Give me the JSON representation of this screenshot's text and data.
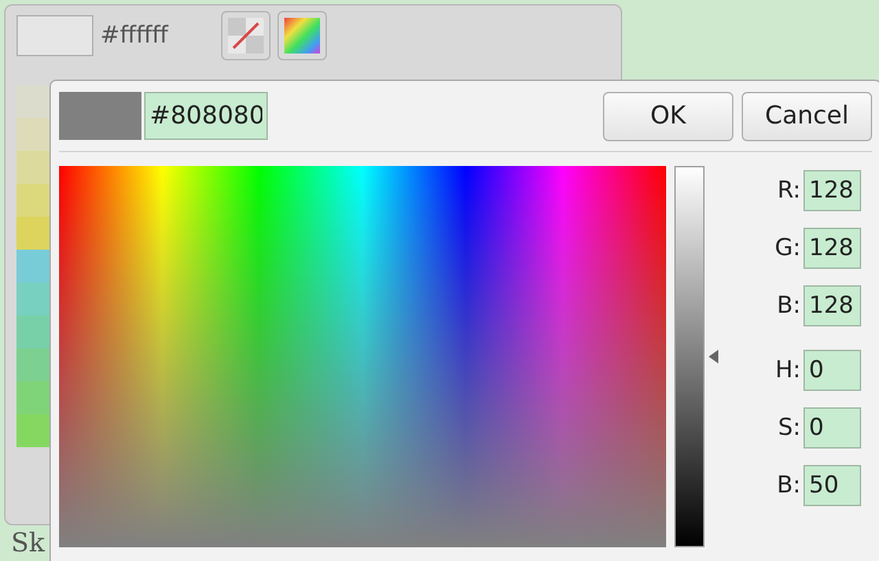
{
  "back_panel": {
    "hex": "#ffffff",
    "swatches": [
      {
        "color": "#dcdccc"
      },
      {
        "color": "#dedcb8"
      },
      {
        "color": "#dcda9c"
      },
      {
        "color": "#dcd87c"
      },
      {
        "color": "#dcd45c"
      },
      {
        "color": "#78ccd8"
      },
      {
        "color": "#78d0c0"
      },
      {
        "color": "#78d0a8"
      },
      {
        "color": "#7cd090"
      },
      {
        "color": "#80d478"
      },
      {
        "color": "#84d860"
      }
    ],
    "footer": "Sk"
  },
  "dialog": {
    "hex": "#808080",
    "buttons": [
      "OK",
      "Cancel"
    ],
    "brightness": {
      "level": 0.5
    },
    "rgb_fields": [
      {
        "label": "R:",
        "value": "128"
      },
      {
        "label": "G:",
        "value": "128"
      },
      {
        "label": "B:",
        "value": "128"
      }
    ],
    "hsb_fields": [
      {
        "label": "H:",
        "value": "0"
      },
      {
        "label": "S:",
        "value": "0"
      },
      {
        "label": "B:",
        "value": "50"
      }
    ]
  }
}
